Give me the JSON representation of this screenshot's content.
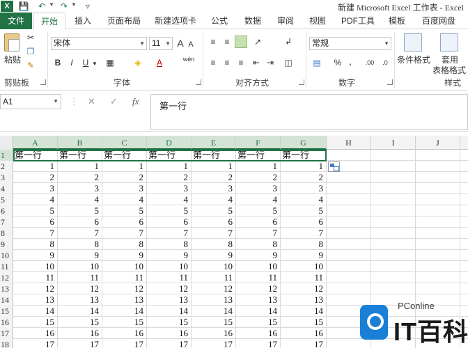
{
  "window": {
    "title": "新建 Microsoft Excel 工作表 - Excel",
    "logo": "X"
  },
  "tabs": [
    {
      "label": "文件"
    },
    {
      "label": "开始"
    },
    {
      "label": "插入"
    },
    {
      "label": "页面布局"
    },
    {
      "label": "新建选项卡"
    },
    {
      "label": "公式"
    },
    {
      "label": "数据"
    },
    {
      "label": "审阅"
    },
    {
      "label": "视图"
    },
    {
      "label": "PDF工具"
    },
    {
      "label": "模板"
    },
    {
      "label": "百度网盘"
    }
  ],
  "ribbon": {
    "paste_label": "粘贴",
    "clipboard_label": "剪贴板",
    "font_group_label": "字体",
    "font_name": "宋体",
    "font_size": "11",
    "bold": "B",
    "italic": "I",
    "underline": "U",
    "grow_font": "A",
    "shrink_font": "A",
    "font_color": "A",
    "phonetic": "wén",
    "align_group_label": "对齐方式",
    "number_group_label": "数字",
    "number_format": "常规",
    "percent": "%",
    "comma": ",",
    "dec_inc": ".00",
    "dec_dec": ".0",
    "cond_format_label": "条件格式",
    "table_format_label_1": "套用",
    "table_format_label_2": "表格格式",
    "styles_label": "样式"
  },
  "formula_bar": {
    "name_box": "A1",
    "fx": "fx",
    "content": "第一行"
  },
  "sheet": {
    "columns": [
      "A",
      "B",
      "C",
      "D",
      "E",
      "F",
      "G",
      "H",
      "I",
      "J"
    ],
    "rows": [
      {
        "n": "1",
        "cells": [
          "第一行",
          "第一行",
          "第一行",
          "第一行",
          "第一行",
          "第一行",
          "第一行"
        ]
      },
      {
        "n": "2",
        "cells": [
          "1",
          "1",
          "1",
          "1",
          "1",
          "1",
          "1"
        ]
      },
      {
        "n": "3",
        "cells": [
          "2",
          "2",
          "2",
          "2",
          "2",
          "2",
          "2"
        ]
      },
      {
        "n": "4",
        "cells": [
          "3",
          "3",
          "3",
          "3",
          "3",
          "3",
          "3"
        ]
      },
      {
        "n": "5",
        "cells": [
          "4",
          "4",
          "4",
          "4",
          "4",
          "4",
          "4"
        ]
      },
      {
        "n": "6",
        "cells": [
          "5",
          "5",
          "5",
          "5",
          "5",
          "5",
          "5"
        ]
      },
      {
        "n": "7",
        "cells": [
          "6",
          "6",
          "6",
          "6",
          "6",
          "6",
          "6"
        ]
      },
      {
        "n": "8",
        "cells": [
          "7",
          "7",
          "7",
          "7",
          "7",
          "7",
          "7"
        ]
      },
      {
        "n": "9",
        "cells": [
          "8",
          "8",
          "8",
          "8",
          "8",
          "8",
          "8"
        ]
      },
      {
        "n": "10",
        "cells": [
          "9",
          "9",
          "9",
          "9",
          "9",
          "9",
          "9"
        ]
      },
      {
        "n": "11",
        "cells": [
          "10",
          "10",
          "10",
          "10",
          "10",
          "10",
          "10"
        ]
      },
      {
        "n": "12",
        "cells": [
          "11",
          "11",
          "11",
          "11",
          "11",
          "11",
          "11"
        ]
      },
      {
        "n": "13",
        "cells": [
          "12",
          "12",
          "12",
          "12",
          "12",
          "12",
          "12"
        ]
      },
      {
        "n": "14",
        "cells": [
          "13",
          "13",
          "13",
          "13",
          "13",
          "13",
          "13"
        ]
      },
      {
        "n": "15",
        "cells": [
          "14",
          "14",
          "14",
          "14",
          "14",
          "14",
          "14"
        ]
      },
      {
        "n": "16",
        "cells": [
          "15",
          "15",
          "15",
          "15",
          "15",
          "15",
          "15"
        ]
      },
      {
        "n": "17",
        "cells": [
          "16",
          "16",
          "16",
          "16",
          "16",
          "16",
          "16"
        ]
      },
      {
        "n": "18",
        "cells": [
          "17",
          "17",
          "17",
          "17",
          "17",
          "17",
          "17"
        ]
      }
    ]
  },
  "watermark": {
    "sub": "PConline",
    "main": "IT百科"
  },
  "colors": {
    "accent": "#217346",
    "selected_header_bg": "#d3e3d6"
  },
  "icons": [
    "save-icon",
    "undo-icon",
    "redo-icon",
    "customize-icon",
    "cut-icon",
    "copy-icon",
    "format-painter-icon",
    "border-icon",
    "fill-color-icon",
    "wrap-text-icon",
    "merge-icon",
    "currency-icon",
    "conditional-format-icon",
    "table-format-icon",
    "cancel-icon",
    "enter-icon",
    "quick-analysis-icon"
  ]
}
